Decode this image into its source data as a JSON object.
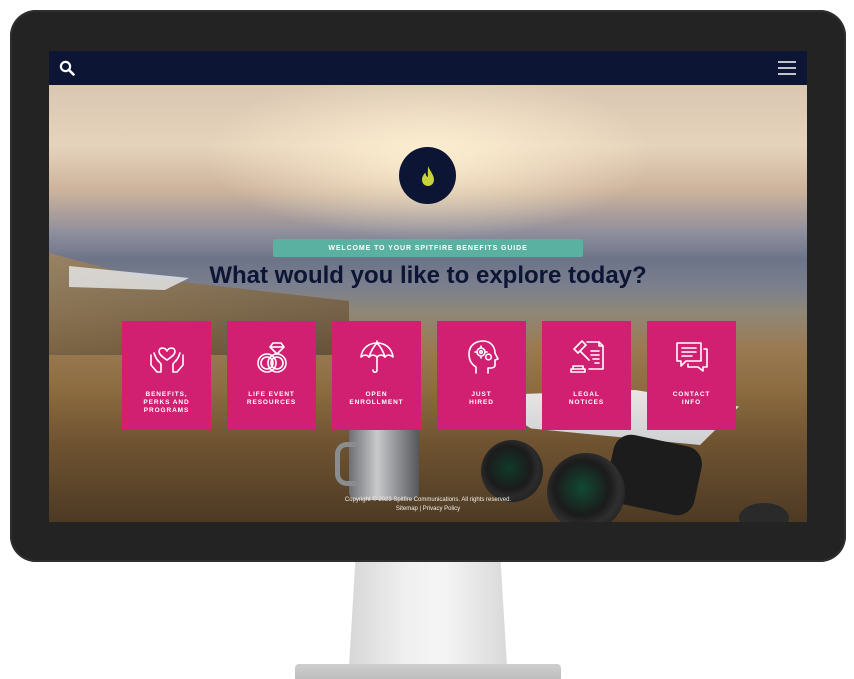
{
  "topbar": {
    "search_icon": "search-icon",
    "menu_icon": "hamburger-menu-icon"
  },
  "hero": {
    "logo_icon": "flame-drop-icon",
    "welcome_banner": "WELCOME TO YOUR SPITFIRE BENEFITS GUIDE",
    "headline": "What would you like to explore today?"
  },
  "tiles": [
    {
      "label": "BENEFITS,\nPERKS AND\nPROGRAMS",
      "icon": "hands-heart-icon"
    },
    {
      "label": "LIFE EVENT\nRESOURCES",
      "icon": "rings-icon"
    },
    {
      "label": "OPEN\nENROLLMENT",
      "icon": "umbrella-icon"
    },
    {
      "label": "JUST\nHIRED",
      "icon": "head-gears-icon"
    },
    {
      "label": "LEGAL\nNOTICES",
      "icon": "gavel-document-icon"
    },
    {
      "label": "CONTACT\nINFO",
      "icon": "chat-bubbles-icon"
    }
  ],
  "footer": {
    "copyright": "Copyright © 2023 Spitfire Communications. All rights reserved.",
    "sitemap": "Sitemap",
    "separator": "|",
    "privacy": "Privacy Policy"
  },
  "colors": {
    "nav": "#0c1533",
    "tile": "#d11f72",
    "banner": "#5bb1a1",
    "logo_accent": "#c8d33a"
  }
}
